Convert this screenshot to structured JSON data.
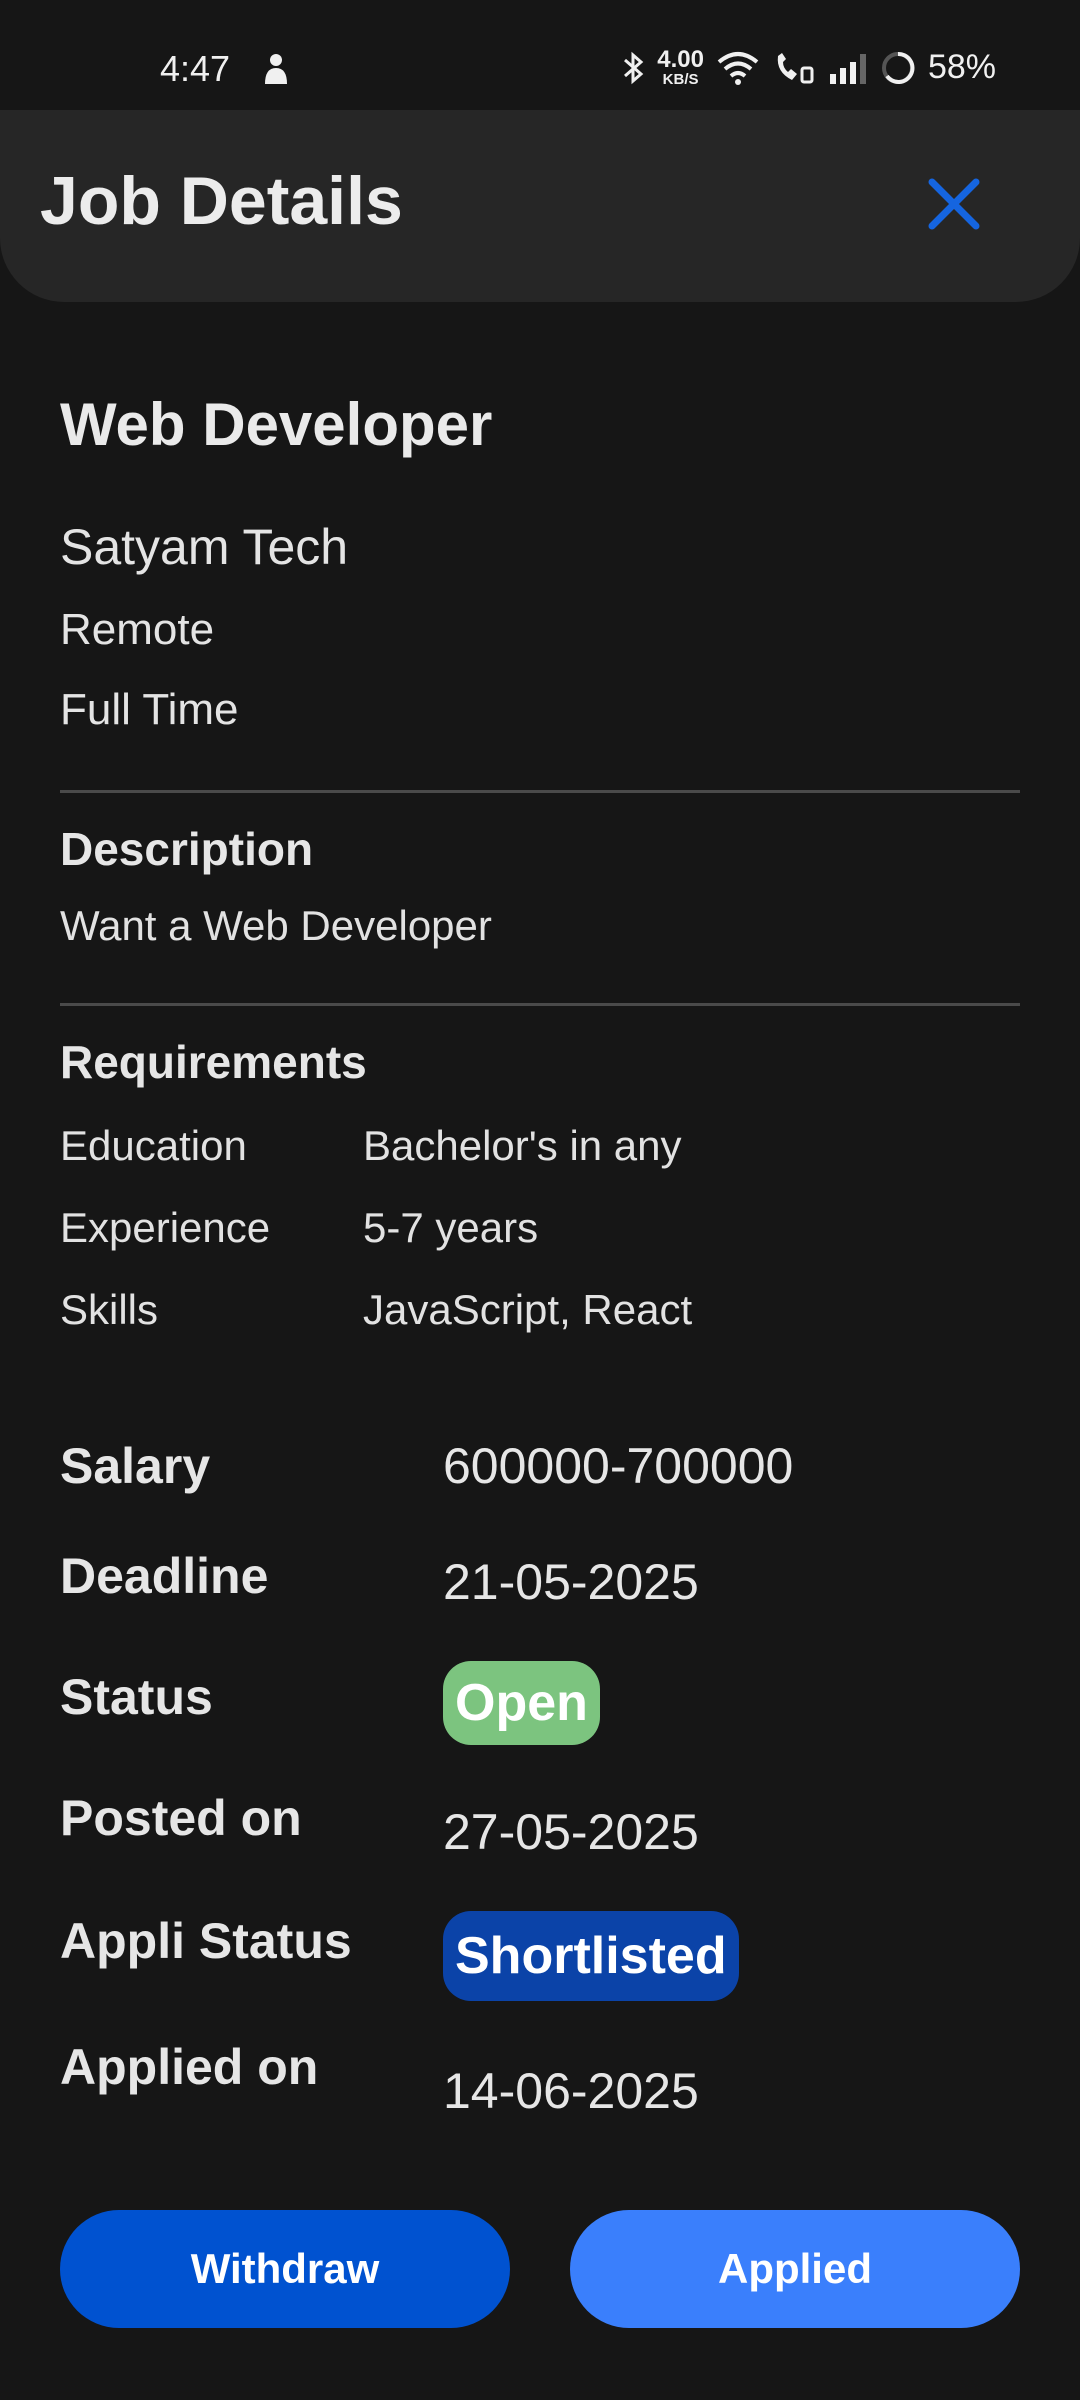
{
  "status_bar": {
    "time": "4:47",
    "net_speed_value": "4.00",
    "net_speed_unit": "KB/S",
    "battery": "58%",
    "icons": [
      "person-notification-icon",
      "bluetooth-icon",
      "wifi-icon",
      "wifi-calling-icon",
      "signal-icon",
      "battery-ring-icon"
    ]
  },
  "header": {
    "title": "Job Details",
    "close_icon": "close-icon",
    "accent": "#1565e0"
  },
  "job": {
    "title": "Web Developer",
    "company": "Satyam Tech",
    "location": "Remote",
    "type": "Full Time"
  },
  "description": {
    "heading": "Description",
    "text": "Want a Web Developer"
  },
  "requirements": {
    "heading": "Requirements",
    "rows": [
      {
        "label": "Education",
        "value": "Bachelor's in any"
      },
      {
        "label": "Experience",
        "value": "5-7 years"
      },
      {
        "label": "Skills",
        "value": "JavaScript, React"
      }
    ]
  },
  "details": {
    "salary_label": "Salary",
    "salary_value": "600000-700000",
    "deadline_label": "Deadline",
    "deadline_value": "21-05-2025",
    "status_label": "Status",
    "status_value": "Open",
    "status_color": "#7cc47f",
    "posted_label": "Posted on",
    "posted_value": "27-05-2025",
    "appli_status_label": "Appli Status",
    "appli_status_value": "Shortlisted",
    "appli_status_color": "#0b43a8",
    "applied_label": "Applied on",
    "applied_value": "14-06-2025"
  },
  "actions": {
    "withdraw_label": "Withdraw",
    "withdraw_color": "#0052d0",
    "applied_label": "Applied",
    "applied_color": "#3a7ffc"
  }
}
